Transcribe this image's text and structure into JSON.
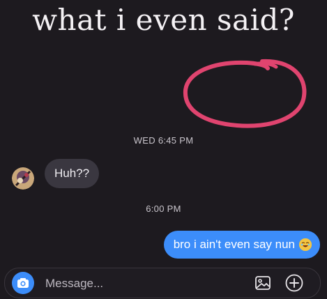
{
  "caption": "what i even said?",
  "thread": {
    "timestamp_1": "WED 6:45 PM",
    "incoming_message": "Huh??",
    "timestamp_2": "6:00 PM",
    "outgoing_message": "bro i ain't even say nun"
  },
  "composer": {
    "placeholder": "Message..."
  },
  "colors": {
    "accent": "#3c8dfa",
    "scribble": "#e0446f",
    "background": "#1d1a1f"
  },
  "icons": [
    "camera-icon",
    "gallery-icon",
    "plus-icon",
    "emoji-icon"
  ]
}
